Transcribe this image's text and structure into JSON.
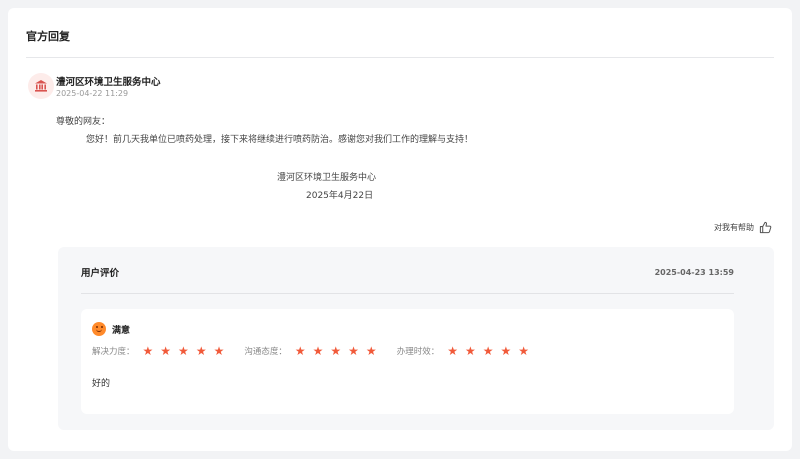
{
  "section_title": "官方回复",
  "reply": {
    "org_name": "澧河区环境卫生服务中心",
    "time": "2025-04-22 11:29",
    "greeting": "尊敬的网友：",
    "content": "您好！前几天我单位已喷药处理，接下来将继续进行喷药防治。感谢您对我们工作的理解与支持！",
    "sign_org": "澧河区环境卫生服务中心",
    "sign_date": "2025年4月22日",
    "helpful_label": "对我有帮助"
  },
  "evaluation": {
    "title": "用户评价",
    "time": "2025-04-23 13:59",
    "mood": "满意",
    "ratings": [
      {
        "label": "解决力度：",
        "stars": 5
      },
      {
        "label": "沟通态度：",
        "stars": 5
      },
      {
        "label": "办理时效：",
        "stars": 5
      }
    ],
    "comment": "好的"
  },
  "colors": {
    "star": "#f15a3a",
    "mood_face": "#ff8a2a",
    "avatar_bg": "#fdecea",
    "avatar_icon": "#d9534f"
  }
}
